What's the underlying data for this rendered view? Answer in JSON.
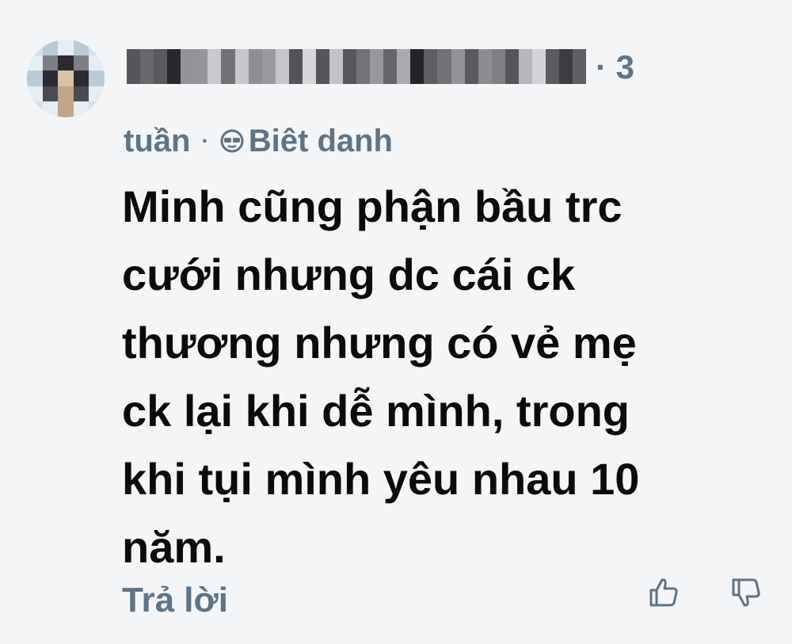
{
  "comment": {
    "author": {
      "name": "",
      "avatar": "avatar-icon"
    },
    "count": "· 3",
    "time": "tuần",
    "separator": "·",
    "nickname_label": "Biêt danh",
    "nickname_icon": "sunglasses-icon",
    "body": "Minh cũng phận bầu trc\ncưới nhưng dc cái ck\nthương nhưng có vẻ mẹ\nck lại khi dễ mình, trong\nkhi tụi mình yêu nhau 10\nnăm.",
    "reply_label": "Trả lời",
    "like_icon": "thumbs-up-icon",
    "dislike_icon": "thumbs-down-icon"
  },
  "colors": {
    "background": "#f4f5f7",
    "meta_text": "#5d7486",
    "body_text": "#0b0b0b"
  }
}
